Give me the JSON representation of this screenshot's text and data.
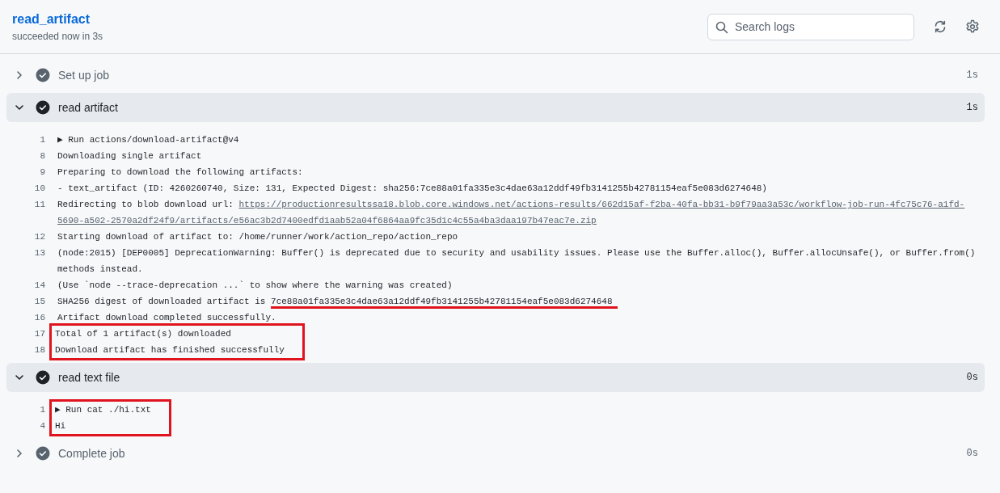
{
  "job": {
    "title": "read_artifact",
    "status": "succeeded now in 3s"
  },
  "search": {
    "placeholder": "Search logs"
  },
  "steps": [
    {
      "name": "Set up job",
      "duration": "1s",
      "expanded": false
    },
    {
      "name": "read artifact",
      "duration": "1s",
      "expanded": true,
      "log": [
        {
          "boxed": false,
          "lines": [
            {
              "number": "1",
              "segments": [
                {
                  "kind": "text",
                  "text": "▶ Run actions/download-artifact@v4"
                }
              ]
            },
            {
              "number": "8",
              "segments": [
                {
                  "kind": "text",
                  "text": "Downloading single artifact"
                }
              ]
            },
            {
              "number": "9",
              "segments": [
                {
                  "kind": "text",
                  "text": "Preparing to download the following artifacts:"
                }
              ]
            },
            {
              "number": "10",
              "segments": [
                {
                  "kind": "text",
                  "text": "- text_artifact (ID: 4260260740, Size: 131, Expected Digest: sha256:7ce88a01fa335e3c4dae63a12ddf49fb3141255b42781154eaf5e083d6274648)"
                }
              ]
            },
            {
              "number": "11",
              "segments": [
                {
                  "kind": "text",
                  "text": "Redirecting to blob download url: "
                },
                {
                  "kind": "link",
                  "text": "https://productionresultssa18.blob.core.windows.net/actions-results/662d15af-f2ba-40fa-bb31-b9f79aa3a53c/workflow-job-run-4fc75c76-a1fd-"
                },
                {
                  "kind": "link",
                  "text": "5690-a502-2570a2df24f9/artifacts/e56ac3b2d7400edfd1aab52a04f6864aa9fc35d1c4c55a4ba3daa197b47eac7e.zip"
                }
              ]
            },
            {
              "number": "12",
              "segments": [
                {
                  "kind": "text",
                  "text": "Starting download of artifact to: /home/runner/work/action_repo/action_repo"
                }
              ]
            },
            {
              "number": "13",
              "segments": [
                {
                  "kind": "text",
                  "text": "(node:2015) [DEP0005] DeprecationWarning: Buffer() is deprecated due to security and usability issues. Please use the Buffer.alloc(), Buffer.allocUnsafe(), or Buffer.from() methods instead."
                }
              ]
            },
            {
              "number": "14",
              "segments": [
                {
                  "kind": "text",
                  "text": "(Use `node --trace-deprecation ...` to show where the warning was created)"
                }
              ]
            },
            {
              "number": "15",
              "segments": [
                {
                  "kind": "text",
                  "text": "SHA256 digest of downloaded artifact is "
                },
                {
                  "kind": "marked",
                  "text": "7ce88a01fa335e3c4dae63a12ddf49fb3141255b42781154eaf5e083d6274648"
                }
              ]
            },
            {
              "number": "16",
              "segments": [
                {
                  "kind": "text",
                  "text": "Artifact download completed successfully."
                }
              ]
            }
          ]
        },
        {
          "boxed": true,
          "lines": [
            {
              "number": "17",
              "segments": [
                {
                  "kind": "text",
                  "text": "Total of 1 artifact(s) downloaded"
                }
              ]
            },
            {
              "number": "18",
              "segments": [
                {
                  "kind": "text",
                  "text": "Download artifact has finished successfully"
                }
              ]
            }
          ]
        }
      ]
    },
    {
      "name": "read text file",
      "duration": "0s",
      "expanded": true,
      "log": [
        {
          "boxed": true,
          "lines": [
            {
              "number": "1",
              "segments": [
                {
                  "kind": "text",
                  "text": "▶ Run cat ./hi.txt"
                }
              ]
            },
            {
              "number": "4",
              "segments": [
                {
                  "kind": "text",
                  "text": "Hi"
                }
              ]
            }
          ]
        }
      ]
    },
    {
      "name": "Complete job",
      "duration": "0s",
      "expanded": false
    }
  ]
}
